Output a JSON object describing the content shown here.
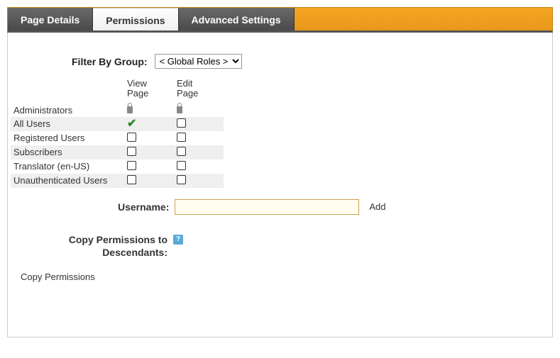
{
  "tabs": [
    {
      "label": "Page Details",
      "active": false
    },
    {
      "label": "Permissions",
      "active": true
    },
    {
      "label": "Advanced Settings",
      "active": false
    }
  ],
  "filter": {
    "label": "Filter By Group:",
    "selected": "< Global Roles >"
  },
  "columns": {
    "role": "",
    "view": "View Page",
    "edit": "Edit Page"
  },
  "roles": [
    {
      "name": "Administrators",
      "view": "lock",
      "edit": "lock",
      "alt": false
    },
    {
      "name": "All Users",
      "view": "check",
      "edit": "unchecked",
      "alt": true
    },
    {
      "name": "Registered Users",
      "view": "unchecked",
      "edit": "unchecked",
      "alt": false
    },
    {
      "name": "Subscribers",
      "view": "unchecked",
      "edit": "unchecked",
      "alt": true
    },
    {
      "name": "Translator (en-US)",
      "view": "unchecked",
      "edit": "unchecked",
      "alt": false
    },
    {
      "name": "Unauthenticated Users",
      "view": "unchecked",
      "edit": "unchecked",
      "alt": true
    }
  ],
  "username": {
    "label": "Username:",
    "value": "",
    "add": "Add"
  },
  "copy": {
    "label": "Copy Permissions to Descendants:",
    "link": "Copy Permissions"
  }
}
